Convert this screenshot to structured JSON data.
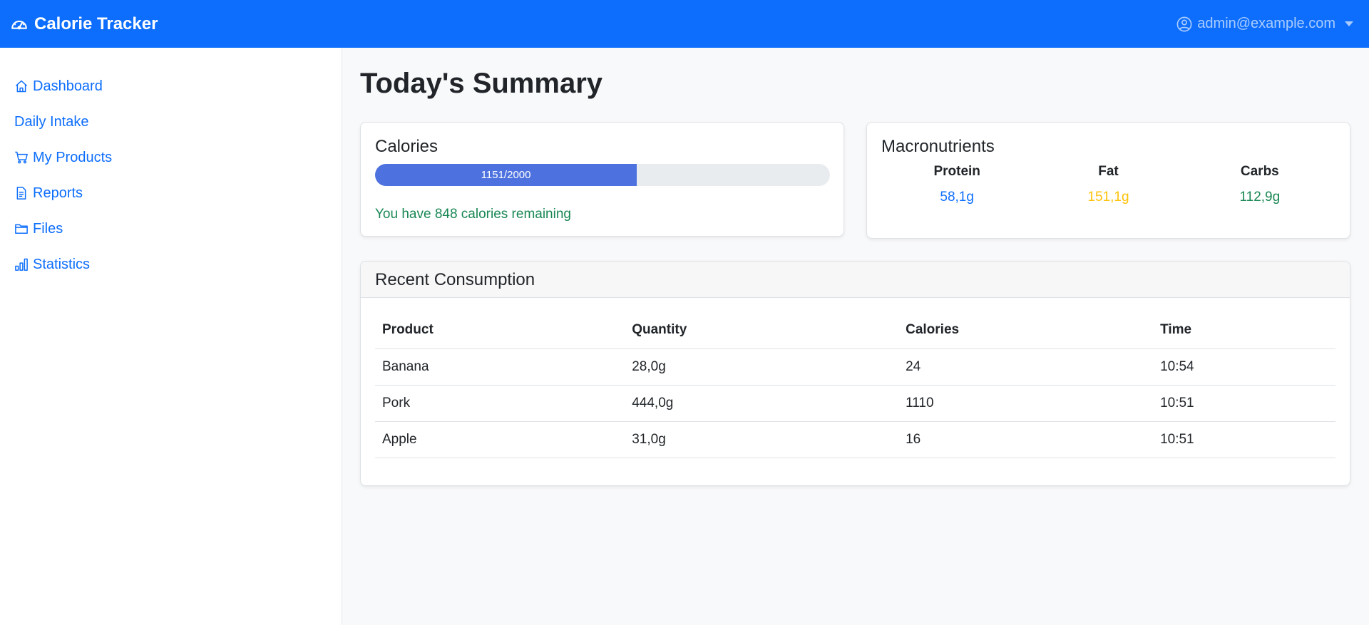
{
  "navbar": {
    "brand": "Calorie Tracker",
    "user": "admin@example.com"
  },
  "sidebar": {
    "items": [
      {
        "label": "Dashboard",
        "icon": "house-icon"
      },
      {
        "label": "Daily Intake",
        "icon": ""
      },
      {
        "label": "My Products",
        "icon": "cart-icon"
      },
      {
        "label": "Reports",
        "icon": "file-text-icon"
      },
      {
        "label": "Files",
        "icon": "folder-icon"
      },
      {
        "label": "Statistics",
        "icon": "bar-chart-icon"
      }
    ]
  },
  "main": {
    "title": "Today's Summary",
    "calories": {
      "title": "Calories",
      "progress_label": "1151/2000",
      "consumed": 1151,
      "goal": 2000,
      "remaining_text": "You have 848 calories remaining",
      "bar_color": "#4d72df"
    },
    "macros": {
      "title": "Macronutrients",
      "items": [
        {
          "label": "Protein",
          "value": "58,1g",
          "color": "#0d6efd"
        },
        {
          "label": "Fat",
          "value": "151,1g",
          "color": "#ffc107"
        },
        {
          "label": "Carbs",
          "value": "112,9g",
          "color": "#198754"
        }
      ]
    },
    "recent": {
      "title": "Recent Consumption",
      "columns": [
        "Product",
        "Quantity",
        "Calories",
        "Time"
      ],
      "rows": [
        [
          "Banana",
          "28,0g",
          "24",
          "10:54"
        ],
        [
          "Pork",
          "444,0g",
          "1110",
          "10:51"
        ],
        [
          "Apple",
          "31,0g",
          "16",
          "10:51"
        ]
      ]
    }
  }
}
